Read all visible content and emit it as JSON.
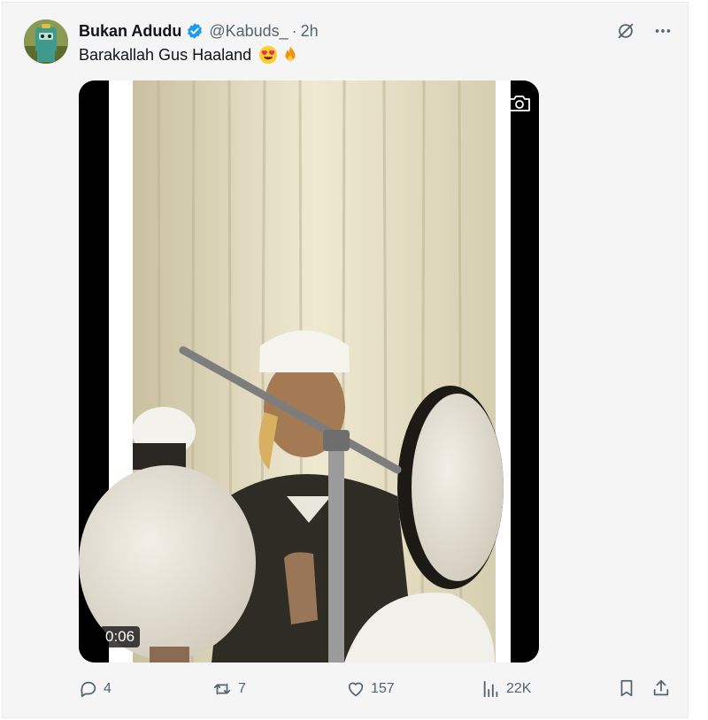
{
  "tweet": {
    "display_name": "Bukan Adudu",
    "handle": "@Kabuds_",
    "separator": "·",
    "time": "2h",
    "text": "Barakallah Gus Haaland",
    "emojis": [
      "smiling-face-with-heart-eyes",
      "fire"
    ]
  },
  "media": {
    "duration": "0:06"
  },
  "stats": {
    "replies": "4",
    "reposts": "7",
    "likes": "157",
    "views": "22K"
  },
  "icons": {
    "verified": "verified-badge-icon",
    "grok": "grok-icon",
    "more": "more-icon",
    "camera": "camera-icon",
    "reply": "reply-icon",
    "repost": "repost-icon",
    "like": "heart-icon",
    "views": "views-icon",
    "bookmark": "bookmark-icon",
    "share": "share-icon"
  },
  "colors": {
    "verified_blue": "#1d9bf0",
    "muted_text": "#536471",
    "text": "#0f1419",
    "card_bg": "#f5f5f5"
  }
}
